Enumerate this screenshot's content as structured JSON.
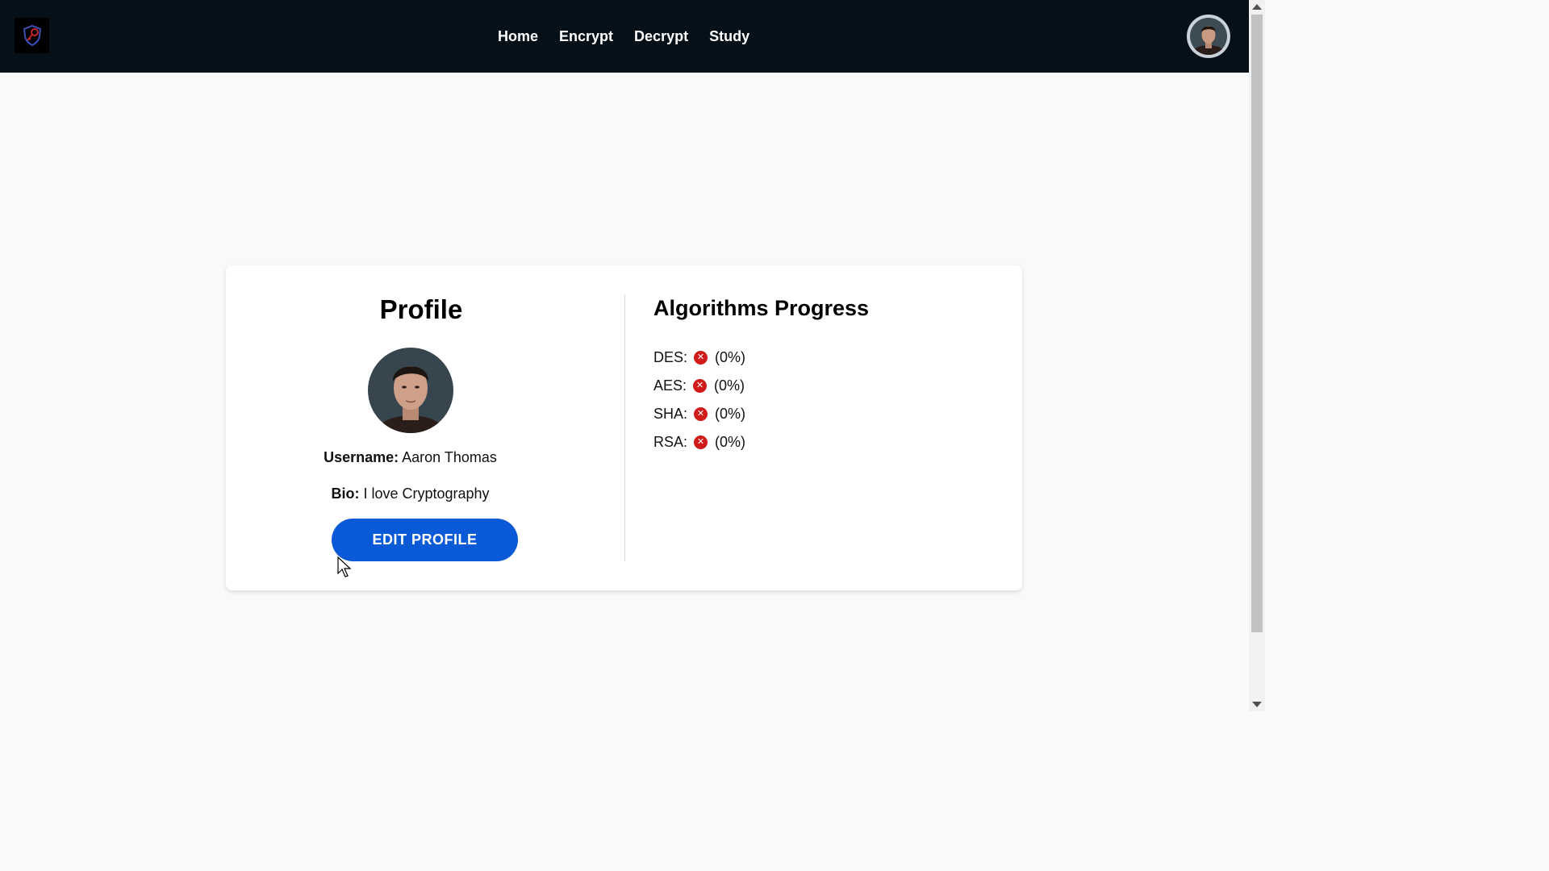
{
  "nav": {
    "logo_icon": "shield-key-icon",
    "links": [
      {
        "label": "Home"
      },
      {
        "label": "Encrypt"
      },
      {
        "label": "Decrypt"
      },
      {
        "label": "Study"
      }
    ],
    "avatar_icon": "user-avatar-icon"
  },
  "profile": {
    "title": "Profile",
    "username_label": "Username:",
    "username_value": "Aaron Thomas",
    "bio_label": "Bio:",
    "bio_value": "I love Cryptography",
    "edit_button": "EDIT PROFILE"
  },
  "progress": {
    "title": "Algorithms Progress",
    "status_icon": "x-circle-icon",
    "status_color": "#d11a1a",
    "items": [
      {
        "name": "DES:",
        "percent": "(0%)"
      },
      {
        "name": "AES:",
        "percent": "(0%)"
      },
      {
        "name": "SHA:",
        "percent": "(0%)"
      },
      {
        "name": "RSA:",
        "percent": "(0%)"
      }
    ]
  },
  "colors": {
    "navbar": "#061019",
    "button": "#0a5ad8",
    "page_background": "#f8f9fb"
  }
}
